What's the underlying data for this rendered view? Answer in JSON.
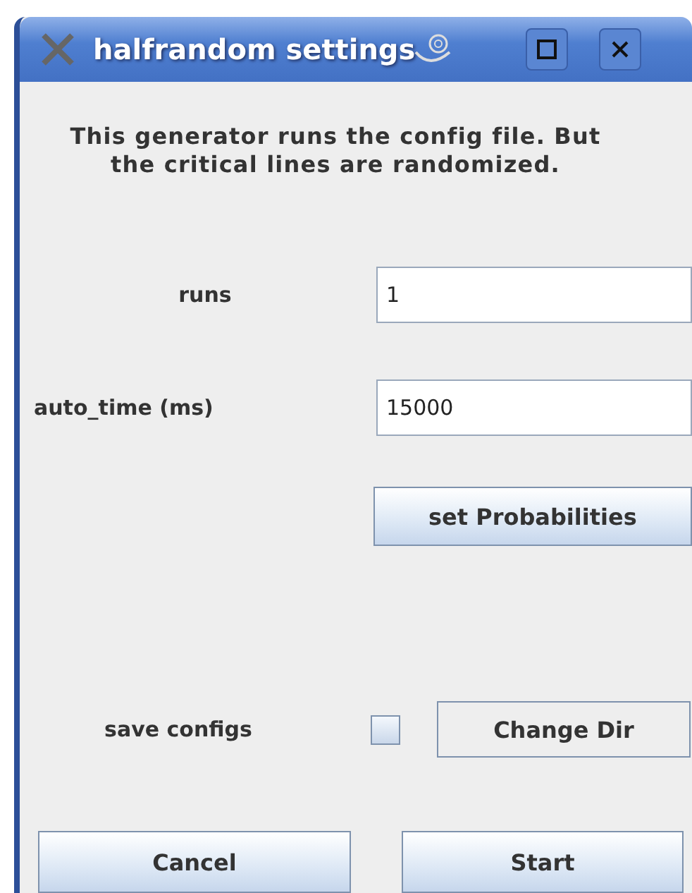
{
  "window": {
    "title": "halfrandom settings"
  },
  "description": "This generator runs the config file. But\nthe critical lines are randomized.",
  "fields": [
    {
      "label": "runs",
      "value": "1"
    },
    {
      "label": "auto_time (ms)",
      "value": "15000"
    }
  ],
  "probabilities_button": "set Probabilities",
  "save_configs": {
    "label": "save configs",
    "checked": false,
    "button": "Change Dir"
  },
  "buttons": [
    "Cancel",
    "Start"
  ]
}
